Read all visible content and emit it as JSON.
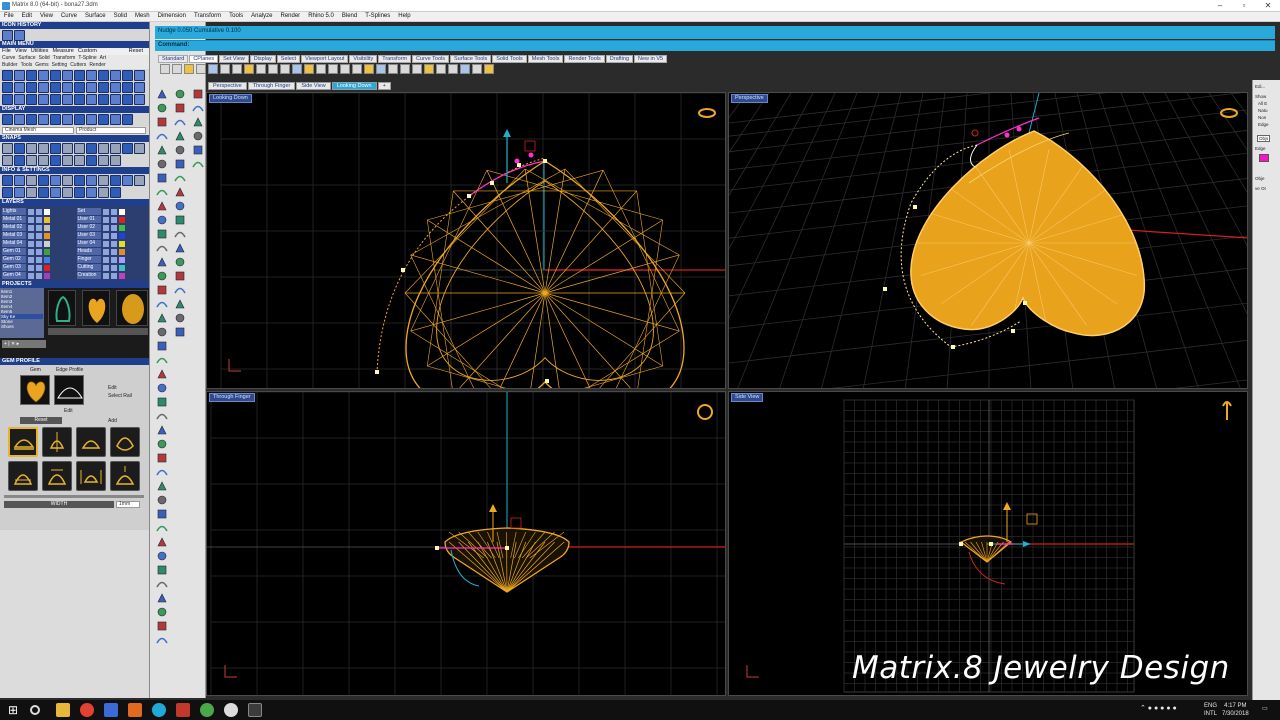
{
  "window": {
    "title": "Matrix 8.0 (64-bit) - bona27.3dm"
  },
  "menu": [
    "File",
    "Edit",
    "View",
    "Curve",
    "Surface",
    "Solid",
    "Mesh",
    "Dimension",
    "Transform",
    "Tools",
    "Analyze",
    "Render",
    "Rhino 5.0",
    "Blend",
    "T-Splines",
    "Help"
  ],
  "left_panel": {
    "icon_history": "ICON HISTORY",
    "main_menu": "MAIN MENU",
    "main_menu_tabs": [
      "File",
      "View",
      "Utilities",
      "Measure",
      "Custom"
    ],
    "reset": "Reset",
    "main_menu_row1": [
      "Curve",
      "Surface",
      "Solid",
      "Transform",
      "T-Spline",
      "Art"
    ],
    "main_menu_row2": [
      "Builder",
      "Tools",
      "Gems",
      "Setting",
      "Cutters",
      "Render"
    ],
    "display": "DISPLAY",
    "display_combo_left": "Cinema Mesh",
    "display_combo_right": "Product",
    "snaps": "SNAPS",
    "info_settings": "INFO & SETTINGS",
    "layers": "LAYERS",
    "layers_left": [
      "Lights",
      "Metal 01",
      "Metal 02",
      "Metal 03",
      "Metal 04",
      "Gem 01",
      "Gem 02",
      "Gem 03",
      "Gem 04"
    ],
    "layers_right": [
      "Set",
      "User 01",
      "User 02",
      "User 03",
      "User 04",
      "Heads",
      "Finger",
      "Cutting",
      "Creation"
    ],
    "layer_colors_left": [
      "#ffffff",
      "#e8c030",
      "#c0c0c0",
      "#e89020",
      "#d0d0d0",
      "#40a040",
      "#4080e0",
      "#e02020",
      "#a040c0"
    ],
    "layer_colors_right": [
      "#ffffff",
      "#e02020",
      "#40c040",
      "#2040e0",
      "#e0e020",
      "#e09020",
      "#a0a0ff",
      "#40c0c0",
      "#c040c0"
    ],
    "projects": "PROJECTS",
    "project_list": [
      "Item1",
      "Item2",
      "Item3",
      "Item4",
      "Item5",
      "Sky Ke",
      "Stone",
      "Shoes"
    ],
    "gem_profile": "GEM PROFILE",
    "gem_tab": "Gem",
    "edge_tab": "Edge Profile",
    "edit": "Edit",
    "select_rail": "Select Rail",
    "reset_btn": "Reset",
    "add_btn": "Add",
    "width": "WIDTH",
    "width_value": "1mm"
  },
  "nudge": "Nudge 0.050  Cumulative 0.100",
  "command": "Command:",
  "toolbar_tabs": [
    "Standard",
    "CPlanes",
    "Set View",
    "Display",
    "Select",
    "Viewport Layout",
    "Visibility",
    "Transform",
    "Curve Tools",
    "Surface Tools",
    "Solid Tools",
    "Mesh Tools",
    "Render Tools",
    "Drafting",
    "New in V5"
  ],
  "view_tabs": [
    "Perspective",
    "Through Finger",
    "Side View",
    "Looking Down"
  ],
  "viewports": {
    "top_left": "Looking Down",
    "top_right": "Perspective",
    "bottom_left": "Through Finger",
    "bottom_right": "Side View"
  },
  "right_panel": {
    "edit": "Edi...",
    "show": "Show",
    "all_e": "All E",
    "natu": "Natu",
    "non": "Non",
    "edge": "Edge",
    "objs": "Objs",
    "edge2": "Edge",
    "obje": "Obje",
    "ve_ot": "ve Ot"
  },
  "colors": {
    "gem_gold": "#f0a820",
    "axis_red": "#d02020",
    "axis_cyan": "#20b0c8",
    "command_blue": "#29a8dc",
    "panel_header": "#1f3e8c"
  },
  "watermark": "Matrix.8 Jewelry Design",
  "taskbar": {
    "lang": "ENG",
    "intl": "INTL",
    "time": "4:17 PM",
    "date": "7/30/2018"
  }
}
